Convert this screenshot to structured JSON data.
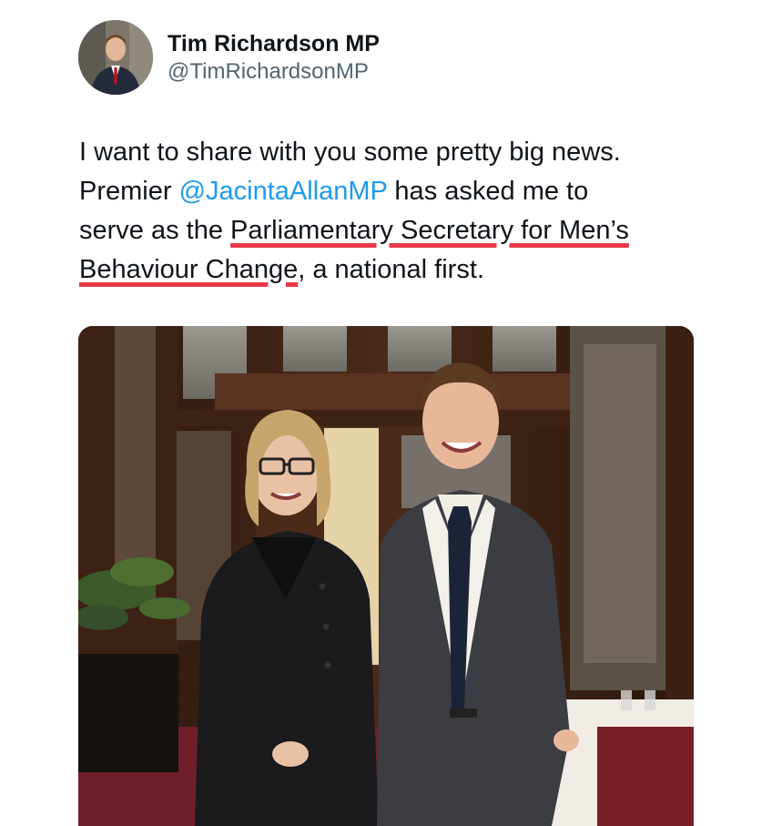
{
  "author": {
    "display_name": "Tim Richardson MP",
    "handle": "@TimRichardsonMP"
  },
  "tweet": {
    "line1": "I want to share with you some pretty big news.",
    "line2_prefix": "Premier ",
    "mention": "@JacintaAllanMP",
    "line2_suffix": " has asked me to",
    "line3_prefix": "serve as the ",
    "highlight_part1": "Parliamentary Secretary for Men’s",
    "highlight_part2": "Behaviour Change",
    "line4_suffix": ", a national first."
  },
  "colors": {
    "mention": "#1d9bf0",
    "underline": "#e83a47",
    "handle": "#536471"
  },
  "media": {
    "alt_subject": "woman-and-man-portrait-photo"
  }
}
